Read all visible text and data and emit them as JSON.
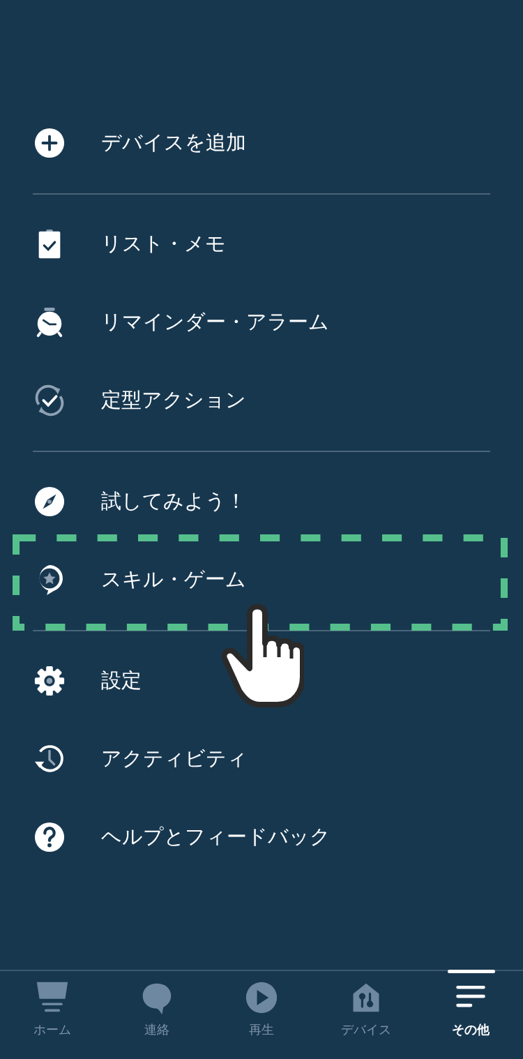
{
  "menu": {
    "sections": [
      {
        "items": [
          {
            "kind": "add",
            "label": "デバイスを追加",
            "highlighted": false
          }
        ]
      },
      {
        "items": [
          {
            "kind": "list",
            "label": "リスト・メモ",
            "highlighted": false
          },
          {
            "kind": "alarm",
            "label": "リマインダー・アラーム",
            "highlighted": false
          },
          {
            "kind": "routine",
            "label": "定型アクション",
            "highlighted": false
          }
        ]
      },
      {
        "items": [
          {
            "kind": "compass",
            "label": "試してみよう！",
            "highlighted": false
          },
          {
            "kind": "skills",
            "label": "スキル・ゲーム",
            "highlighted": true
          }
        ]
      },
      {
        "items": [
          {
            "kind": "settings",
            "label": "設定",
            "highlighted": false
          },
          {
            "kind": "activity",
            "label": "アクティビティ",
            "highlighted": false
          },
          {
            "kind": "help",
            "label": "ヘルプとフィードバック",
            "highlighted": false
          }
        ]
      }
    ]
  },
  "tab_bar": {
    "tabs": [
      {
        "kind": "home",
        "label": "ホーム",
        "selected": false
      },
      {
        "kind": "chat",
        "label": "連絡",
        "selected": false
      },
      {
        "kind": "play",
        "label": "再生",
        "selected": false
      },
      {
        "kind": "devices",
        "label": "デバイス",
        "selected": false
      },
      {
        "kind": "more",
        "label": "その他",
        "selected": true
      }
    ]
  }
}
